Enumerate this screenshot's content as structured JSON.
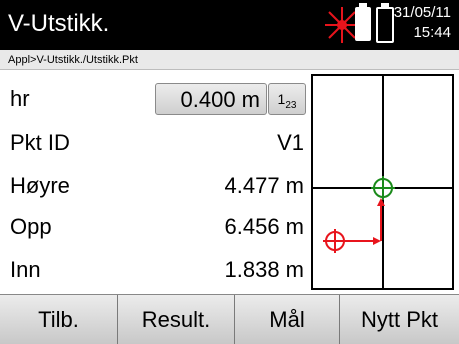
{
  "header": {
    "title": "V-Utstikk.",
    "date": "31/05/11",
    "time": "15:44",
    "icons": [
      "laser-icon",
      "battery-full-icon",
      "battery-empty-icon"
    ],
    "laser_color": "#e8141c"
  },
  "breadcrumb": "Appl>V-Utstikk./Utstikk.Pkt",
  "fields": {
    "hr": {
      "label": "hr",
      "value": "0.400 m",
      "mode_label": "123"
    },
    "point_id": {
      "label": "Pkt ID",
      "value": "V1"
    },
    "right": {
      "label": "Høyre",
      "value": "4.477 m"
    },
    "up": {
      "label": "Opp",
      "value": "6.456 m"
    },
    "in": {
      "label": "Inn",
      "value": "1.838 m"
    }
  },
  "graphic": {
    "target_color": "#1a8a1a",
    "current_color": "#e8141c"
  },
  "softkeys": [
    "Tilb.",
    "Result.",
    "Mål",
    "Nytt Pkt"
  ]
}
